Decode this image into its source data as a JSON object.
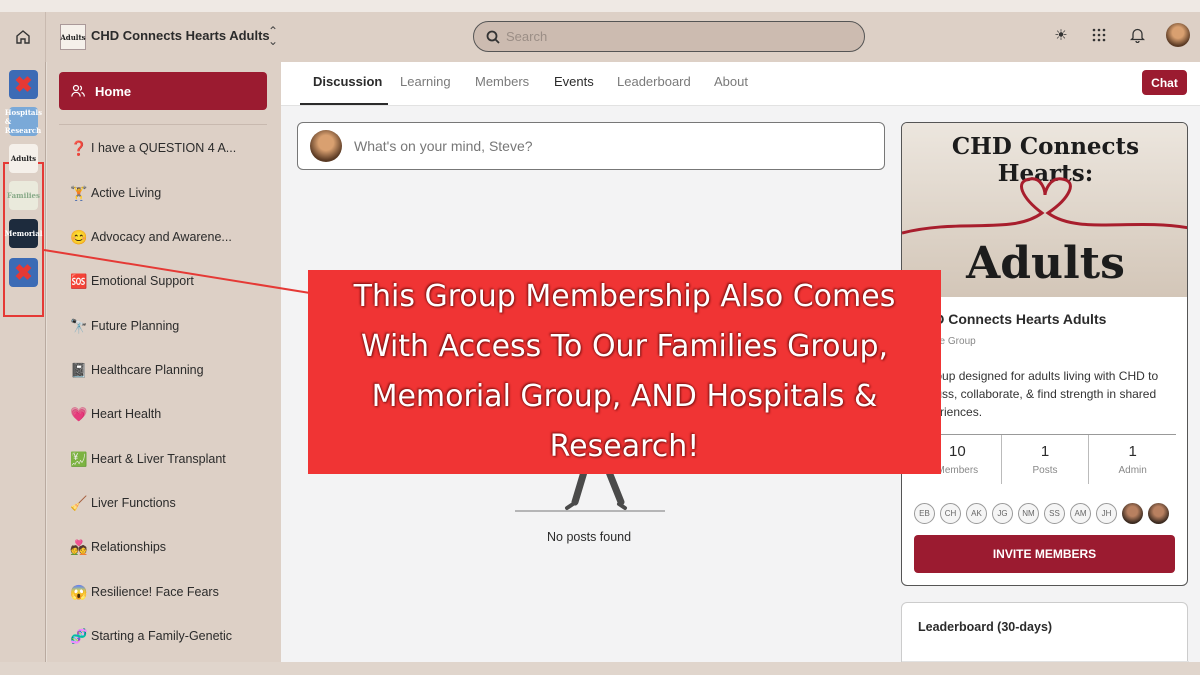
{
  "topbar": {
    "group_logo_text": "Adults",
    "group_name": "CHD Connects Hearts Adults",
    "search_placeholder": "Search",
    "icons": [
      "home-icon",
      "chevron-updown-icon",
      "search-icon",
      "sun-icon",
      "apps-grid-icon",
      "bell-icon",
      "user-avatar"
    ]
  },
  "rail": {
    "items": [
      {
        "label": "",
        "icon": "close-x-icon"
      },
      {
        "label": "Hospitals & Research"
      },
      {
        "label": "Adults"
      },
      {
        "label": "Families"
      },
      {
        "label": "Memorial"
      },
      {
        "label": "",
        "icon": "close-x-icon"
      }
    ]
  },
  "sidebar": {
    "home_label": "Home",
    "items": [
      {
        "emoji": "❓",
        "label": "I have a QUESTION 4 A..."
      },
      {
        "emoji": "🏋",
        "label": "Active Living"
      },
      {
        "emoji": "😊",
        "label": "Advocacy and Awarene..."
      },
      {
        "emoji": "🆘",
        "label": "Emotional Support"
      },
      {
        "emoji": "🔭",
        "label": "Future Planning"
      },
      {
        "emoji": "📓",
        "label": "Healthcare Planning"
      },
      {
        "emoji": "💗",
        "label": "Heart Health"
      },
      {
        "emoji": "💹",
        "label": "Heart & Liver Transplant"
      },
      {
        "emoji": "🧹",
        "label": "Liver Functions"
      },
      {
        "emoji": "💑",
        "label": "Relationships"
      },
      {
        "emoji": "😱",
        "label": "Resilience! Face Fears"
      },
      {
        "emoji": "🧬",
        "label": "Starting a Family-Genetic"
      }
    ]
  },
  "tabs": [
    {
      "label": "Discussion",
      "active": true
    },
    {
      "label": "Learning"
    },
    {
      "label": "Members"
    },
    {
      "label": "Events"
    },
    {
      "label": "Leaderboard"
    },
    {
      "label": "About"
    }
  ],
  "chat_label": "Chat",
  "composer": {
    "placeholder": "What's on your mind, Steve?"
  },
  "feed": {
    "empty_text": "No posts found"
  },
  "group_card": {
    "banner_line1": "CHD Connects Hearts:",
    "banner_line2": "Adults",
    "name": "CHD Connects Hearts Adults",
    "privacy": "Private Group",
    "description": "A group designed for adults living with CHD to discuss, collaborate, & find strength in shared experiences.",
    "stats": [
      {
        "value": "10",
        "label": "Members"
      },
      {
        "value": "1",
        "label": "Posts"
      },
      {
        "value": "1",
        "label": "Admin"
      }
    ],
    "member_initials": [
      "EB",
      "CH",
      "AK",
      "JG",
      "NM",
      "SS",
      "AM",
      "JH"
    ],
    "invite_label": "INVITE MEMBERS"
  },
  "leaderboard": {
    "title": "Leaderboard (30-days)"
  },
  "promo": {
    "text": "This Group Membership Also Comes With Access To Our Families Group, Memorial Group, AND Hospitals & Research!"
  },
  "colors": {
    "accent": "#9b1b30",
    "promo_bg": "#f03434",
    "sidebar_bg": "#ddd0c6"
  }
}
